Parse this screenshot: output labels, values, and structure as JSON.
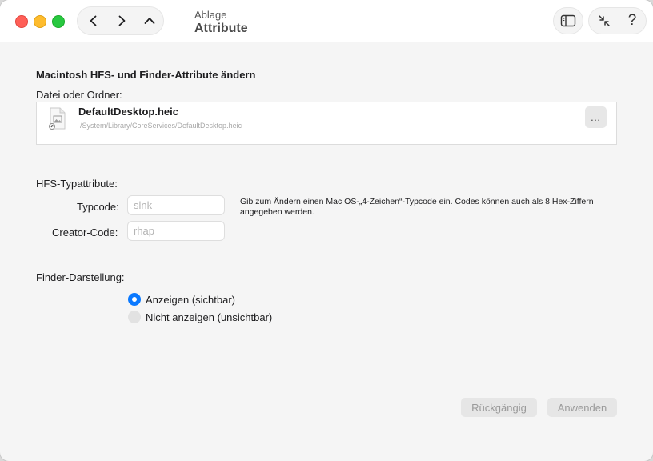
{
  "window": {
    "title_sub": "Ablage",
    "title_main": "Attribute"
  },
  "nav": {
    "back_icon": "chevron-left-icon",
    "forward_icon": "chevron-right-icon",
    "up_icon": "chevron-up-icon"
  },
  "toolbar": {
    "sidebar_icon": "sidebar-icon",
    "collapse_icon": "collapse-arrows-icon",
    "help_glyph": "?"
  },
  "section": {
    "title": "Macintosh HFS- und Finder-Attribute ändern",
    "file_label": "Datei oder Ordner:"
  },
  "file": {
    "name": "DefaultDesktop.heic",
    "path": "/System/Library/CoreServices/DefaultDesktop.heic",
    "more_label": "…"
  },
  "hfs": {
    "title": "HFS-Typattribute:",
    "typecode_label": "Typcode:",
    "typecode_placeholder": "slnk",
    "creator_label": "Creator-Code:",
    "creator_placeholder": "rhap",
    "help_text": "Gib zum Ändern einen Mac OS-„4-Zeichen“-Typcode ein. Codes können auch als 8 Hex-Ziffern angegeben werden."
  },
  "finder": {
    "title": "Finder-Darstellung:",
    "options": [
      {
        "label": "Anzeigen (sichtbar)",
        "selected": true
      },
      {
        "label": "Nicht anzeigen (unsichtbar)",
        "selected": false
      }
    ]
  },
  "buttons": {
    "revert": "Rückgängig",
    "apply": "Anwenden"
  },
  "colors": {
    "accent": "#0a79ff",
    "close": "#ff5f57",
    "minimize": "#febc2e",
    "maximize": "#28c840"
  }
}
